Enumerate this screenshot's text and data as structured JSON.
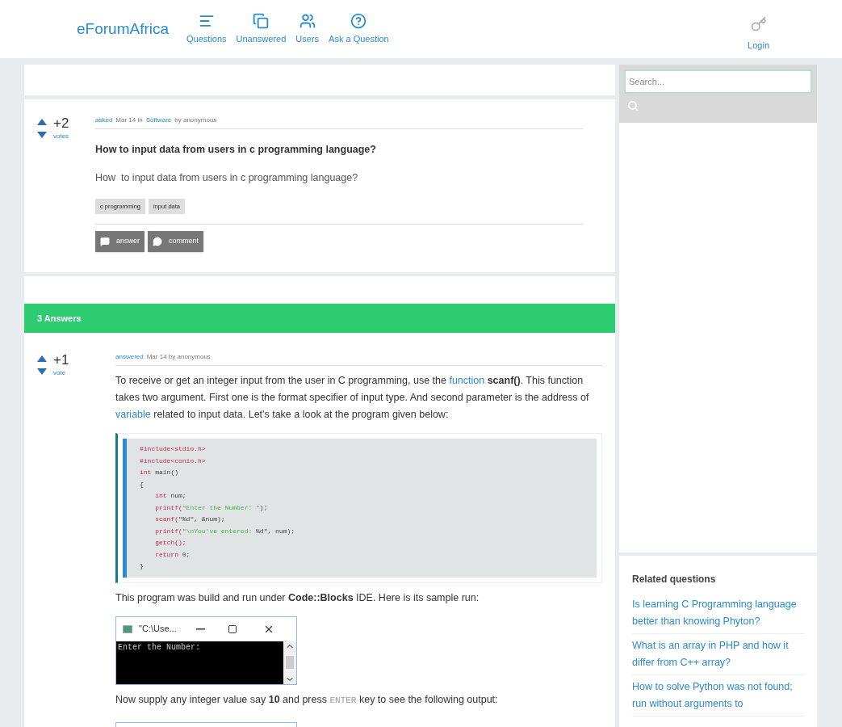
{
  "header": {
    "logo": "eForumAfrica",
    "nav": [
      {
        "label": "Questions"
      },
      {
        "label": "Unanswered"
      },
      {
        "label": "Users"
      },
      {
        "label": "Ask a Question"
      }
    ],
    "login": "Login"
  },
  "question": {
    "votes": "+2",
    "votes_label": "votes",
    "meta": [
      {
        "text": "asked",
        "kind": "link"
      },
      {
        "text": "Mar 14 in",
        "kind": "text"
      },
      {
        "text": "Software",
        "kind": "link"
      },
      {
        "text": "by anonymous",
        "kind": "text"
      }
    ],
    "title": "How to input data from users in c programming language?",
    "body": "How  to input data from users in c programming language?",
    "tags": [
      "c programming",
      "input data"
    ],
    "buttons": [
      "answer",
      "comment"
    ]
  },
  "answers_heading": "3 Answers",
  "answer": {
    "votes": "+1",
    "votes_label": "vote",
    "meta": [
      {
        "text": "answered",
        "kind": "link"
      },
      {
        "text": "Mar 14 by anonymous",
        "kind": "text"
      }
    ],
    "intro": [
      {
        "text": "To receive or get an integer input from the user in C programming, use the ",
        "kind": "text"
      },
      {
        "text": "function",
        "kind": "link"
      },
      {
        "text": " scanf()",
        "kind": "bold"
      },
      {
        "text": ". This function takes two argument. First one is the format specifier of input type. And second parameter is the address of ",
        "kind": "text"
      },
      {
        "text": "variable",
        "kind": "link"
      },
      {
        "text": " related to input data. Let's take a look at the program given below:",
        "kind": "text"
      }
    ],
    "code": [
      [
        {
          "text": "#include<stdio.h>",
          "kind": "keyword"
        }
      ],
      [
        {
          "text": "#include<conio.h>",
          "kind": "keyword"
        }
      ],
      [
        {
          "text": "int",
          "kind": "keyword"
        },
        {
          "text": " main()",
          "kind": "plain"
        }
      ],
      [
        {
          "text": "{",
          "kind": "plain"
        }
      ],
      [
        {
          "text": "    int",
          "kind": "keyword"
        },
        {
          "text": " num;",
          "kind": "plain"
        }
      ],
      [
        {
          "text": "    printf(",
          "kind": "keyword"
        },
        {
          "text": "\"Enter the Number: \"",
          "kind": "string"
        },
        {
          "text": ");",
          "kind": "plain"
        }
      ],
      [
        {
          "text": "    scanf(",
          "kind": "keyword"
        },
        {
          "text": "\"%d\"",
          "kind": "plain"
        },
        {
          "text": ", &num);",
          "kind": "plain"
        }
      ],
      [
        {
          "text": "    printf(",
          "kind": "keyword"
        },
        {
          "text": "\"\\nYou've entered: ",
          "kind": "string"
        },
        {
          "text": "%d\", num);",
          "kind": "plain"
        }
      ],
      [
        {
          "text": "    getch();",
          "kind": "keyword"
        }
      ],
      [
        {
          "text": "    return",
          "kind": "keyword"
        },
        {
          "text": " 0;",
          "kind": "plain"
        }
      ],
      [
        {
          "text": "}",
          "kind": "plain"
        }
      ]
    ],
    "after_code": [
      {
        "text": "This program was build and run under ",
        "kind": "text"
      },
      {
        "text": "Code::Blocks",
        "kind": "bold"
      },
      {
        "text": " IDE. Here is its sample run:",
        "kind": "text"
      }
    ],
    "console": {
      "title": "\"C:\\Use...",
      "output": "Enter the Number:"
    },
    "after_console": [
      {
        "text": "Now supply any integer value say ",
        "kind": "text"
      },
      {
        "text": "10",
        "kind": "bold"
      },
      {
        "text": " and press ",
        "kind": "text"
      },
      {
        "text": "ENTER",
        "kind": "code"
      },
      {
        "text": " key to see the following output:",
        "kind": "text"
      }
    ]
  },
  "sidebar": {
    "search": {
      "placeholder": "Search..."
    },
    "related_title": "Related questions",
    "related": [
      "Is learning C Programming language better than knowing Phyton?",
      "What is an array in PHP and how it differ from C++ array?",
      "How to solve Python was not found; run without arguments to"
    ]
  }
}
